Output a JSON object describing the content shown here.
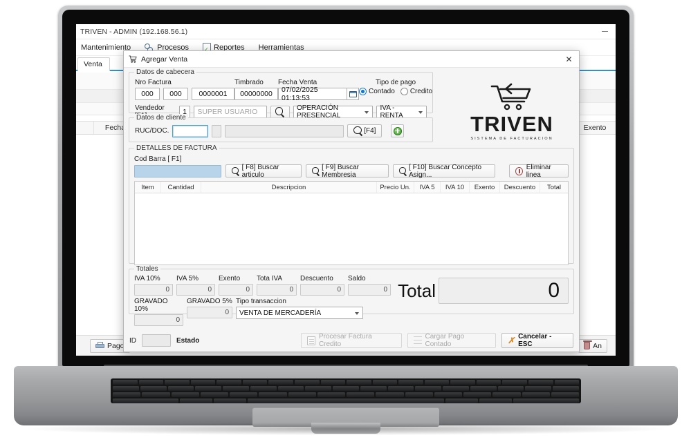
{
  "background_window": {
    "title": "TRIVEN - ADMIN (192.168.56.1)",
    "window_controls": {
      "minimize": "minimize-icon"
    },
    "menu": [
      {
        "label": "Mantenimiento",
        "icon": ""
      },
      {
        "label": "Procesos",
        "icon": "gear-icon"
      },
      {
        "label": "Reportes",
        "icon": "report-icon"
      },
      {
        "label": "Herramientas",
        "icon": ""
      }
    ],
    "tab": {
      "label": "Venta"
    },
    "grid_columns": [
      "Fecha",
      "Exento"
    ],
    "bottom_buttons": [
      {
        "label": "Pago",
        "icon": "printer-icon"
      },
      {
        "label": "An",
        "icon": "trash-icon"
      }
    ]
  },
  "modal": {
    "title": "Agregar Venta",
    "title_icon": "cart-icon",
    "close_icon": "close-icon",
    "header_group": {
      "legend": "Datos de cabecera",
      "nro_factura_label": "Nro Factura",
      "nro_factura_1": "000",
      "nro_factura_2": "000",
      "nro_factura_3": "0000001",
      "timbrado_label": "Timbrado",
      "timbrado_value": "00000000",
      "fecha_venta_label": "Fecha Venta",
      "fecha_venta_value": "07/02/2025 01:13:53",
      "calendar_icon": "calendar-icon",
      "tipo_pago_label": "Tipo de pago",
      "tipo_pago_options": [
        {
          "label": "Contado",
          "selected": true
        },
        {
          "label": "Credito",
          "selected": false
        }
      ],
      "vendedor_label": "Vendedor [F1]",
      "vendedor_code": "1",
      "vendedor_name_placeholder": "SUPER USUARIO",
      "vendedor_search_icon": "search-icon",
      "operacion_value": "OPERACIÓN PRESENCIAL",
      "impuesto_value": "IVA - RENTA"
    },
    "client_group": {
      "legend": "Datos de cliente",
      "ruc_label": "RUC/DOC.",
      "ruc_value": "",
      "dv_value": "",
      "nombre_value": "",
      "buscar_button": "[F4]",
      "buscar_icon": "search-icon",
      "add_button_icon": "add-circle-icon"
    },
    "details_group": {
      "legend": "DETALLES DE FACTURA",
      "cod_barra_label": "Cod Barra [ F1]",
      "cod_barra_value": "",
      "buttons": [
        {
          "label": "[ F8] Buscar articulo",
          "icon": "search-icon"
        },
        {
          "label": "[ F9] Buscar Membresia",
          "icon": "search-icon"
        },
        {
          "label": "[ F10] Buscar Concepto Asign...",
          "icon": "search-icon"
        },
        {
          "label": "Eliminar linea",
          "icon": "delete-icon"
        }
      ],
      "columns": [
        "Item",
        "Cantidad",
        "Descripcion",
        "Precio Un.",
        "IVA 5",
        "IVA 10",
        "Exento",
        "Descuento",
        "Total"
      ],
      "rows": []
    },
    "totals_group": {
      "legend": "Totales",
      "fields": [
        {
          "label": "IVA 10%",
          "value": "0"
        },
        {
          "label": "IVA 5%",
          "value": "0"
        },
        {
          "label": "Exento",
          "value": "0"
        },
        {
          "label": "Tota IVA",
          "value": "0"
        },
        {
          "label": "Descuento",
          "value": "0"
        },
        {
          "label": "Saldo",
          "value": "0"
        }
      ],
      "fields_row2": [
        {
          "label": "GRAVADO 10%",
          "value": "0"
        },
        {
          "label": "GRAVADO 5%",
          "value": "0"
        }
      ],
      "tipo_transaccion_label": "Tipo transaccion",
      "tipo_transaccion_value": "VENTA DE MERCADERÍA",
      "total_label": "Total",
      "total_value": "0"
    },
    "footer": {
      "id_label": "ID",
      "id_value": "",
      "estado_label": "Estado",
      "buttons": [
        {
          "label": "Procesar Factura Credito",
          "icon": "invoice-icon",
          "disabled": true
        },
        {
          "label": "Cargar Pago Contado",
          "icon": "payment-icon",
          "disabled": true
        },
        {
          "label": "Cancelar - ESC",
          "icon": "cancel-icon",
          "disabled": false
        }
      ]
    },
    "logo": {
      "wordmark": "TRIVEN",
      "tagline": "SISTEMA DE FACTURACION",
      "icon": "shopping-cart-icon"
    }
  },
  "colors": {
    "accent": "#2f8fd0",
    "radio_selected": "#1878c8",
    "add_green": "#3f9a32",
    "cancel_orange": "#d98c2b",
    "delete_red": "#9c4b4b"
  }
}
